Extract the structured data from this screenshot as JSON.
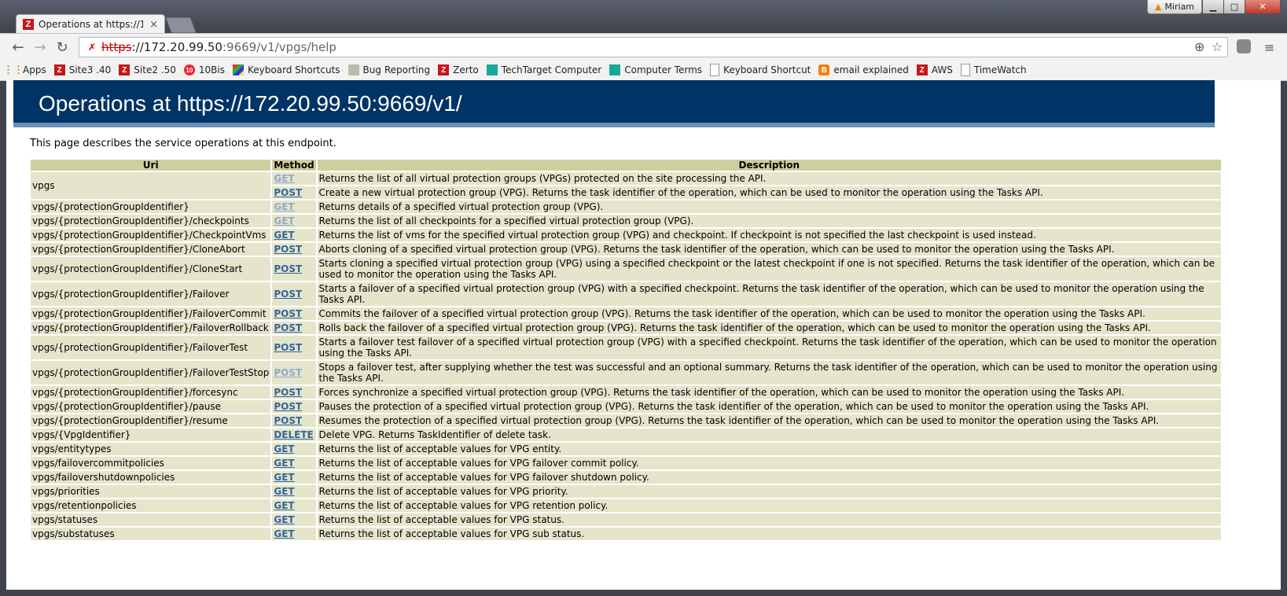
{
  "browser": {
    "tab_title": "Operations at https://172.",
    "tab_close": "×",
    "profile_name": "Miriam",
    "url_scheme": "https",
    "url_host": "://172.20.99.50",
    "url_path": ":9669/v1/vpgs/help"
  },
  "bookmarks": [
    {
      "label": "Apps",
      "icon": "apps-grid-icon"
    },
    {
      "label": "Site3 .40",
      "icon": "zerto-icon"
    },
    {
      "label": "Site2 .50",
      "icon": "zerto-icon"
    },
    {
      "label": "10Bis",
      "icon": "tenbis-icon"
    },
    {
      "label": "Keyboard Shortcuts",
      "icon": "colorful-icon"
    },
    {
      "label": "Bug Reporting",
      "icon": "bug-icon"
    },
    {
      "label": "Zerto",
      "icon": "zerto-icon"
    },
    {
      "label": "TechTarget Computer",
      "icon": "teal-icon"
    },
    {
      "label": "Computer Terms",
      "icon": "teal-icon"
    },
    {
      "label": "Keyboard Shortcut",
      "icon": "page-icon"
    },
    {
      "label": "email explained",
      "icon": "blogger-icon"
    },
    {
      "label": "AWS",
      "icon": "zerto-icon"
    },
    {
      "label": "TimeWatch",
      "icon": "page-icon"
    }
  ],
  "page": {
    "heading": "Operations at https://172.20.99.50:9669/v1/",
    "intro": "This page describes the service operations at this endpoint.",
    "columns": {
      "uri": "Uri",
      "method": "Method",
      "description": "Description"
    },
    "rows": [
      {
        "uri": "vpgs",
        "method": "GET",
        "visited": true,
        "desc": "Returns the list of all virtual protection groups (VPGs) protected on the site processing the API.",
        "rowspan": 2
      },
      {
        "uri": null,
        "method": "POST",
        "visited": false,
        "desc": "Create a new virtual protection group (VPG). Returns the task identifier of the operation, which can be used to monitor the operation using the Tasks API."
      },
      {
        "uri": "vpgs/{protectionGroupIdentifier}",
        "method": "GET",
        "visited": true,
        "desc": "Returns details of a specified virtual protection group (VPG)."
      },
      {
        "uri": "vpgs/{protectionGroupIdentifier}/checkpoints",
        "method": "GET",
        "visited": true,
        "desc": "Returns the list of all checkpoints for a specified virtual protection group (VPG)."
      },
      {
        "uri": "vpgs/{protectionGroupIdentifier}/CheckpointVms",
        "method": "GET",
        "visited": false,
        "desc": "Returns the list of vms for the specified virtual protection group (VPG) and checkpoint. If checkpoint is not specified the last checkpoint is used instead."
      },
      {
        "uri": "vpgs/{protectionGroupIdentifier}/CloneAbort",
        "method": "POST",
        "visited": false,
        "desc": "Aborts cloning of a specified virtual protection group (VPG). Returns the task identifier of the operation, which can be used to monitor the operation using the Tasks API."
      },
      {
        "uri": "vpgs/{protectionGroupIdentifier}/CloneStart",
        "method": "POST",
        "visited": false,
        "desc": "Starts cloning a specified virtual protection group (VPG) using a specified checkpoint or the latest checkpoint if one is not specified. Returns the task identifier of the operation, which can be used to monitor the operation using the Tasks API."
      },
      {
        "uri": "vpgs/{protectionGroupIdentifier}/Failover",
        "method": "POST",
        "visited": false,
        "desc": "Starts a failover of a specified virtual protection group (VPG) with a specified checkpoint. Returns the task identifier of the operation, which can be used to monitor the operation using the Tasks API."
      },
      {
        "uri": "vpgs/{protectionGroupIdentifier}/FailoverCommit",
        "method": "POST",
        "visited": false,
        "desc": "Commits the failover of a specified virtual protection group (VPG). Returns the task identifier of the operation, which can be used to monitor the operation using the Tasks API."
      },
      {
        "uri": "vpgs/{protectionGroupIdentifier}/FailoverRollback",
        "method": "POST",
        "visited": false,
        "desc": "Rolls back the failover of a specified virtual protection group (VPG). Returns the task identifier of the operation, which can be used to monitor the operation using the Tasks API."
      },
      {
        "uri": "vpgs/{protectionGroupIdentifier}/FailoverTest",
        "method": "POST",
        "visited": false,
        "desc": "Starts a failover test failover of a specified virtual protection group (VPG) with a specified checkpoint. Returns the task identifier of the operation, which can be used to monitor the operation using the Tasks API."
      },
      {
        "uri": "vpgs/{protectionGroupIdentifier}/FailoverTestStop",
        "method": "POST",
        "visited": true,
        "desc": "Stops a failover test, after supplying whether the test was successful and an optional summary. Returns the task identifier of the operation, which can be used to monitor the operation using the Tasks API."
      },
      {
        "uri": "vpgs/{protectionGroupIdentifier}/forcesync",
        "method": "POST",
        "visited": false,
        "desc": "Forces synchronize a specified virtual protection group (VPG). Returns the task identifier of the operation, which can be used to monitor the operation using the Tasks API."
      },
      {
        "uri": "vpgs/{protectionGroupIdentifier}/pause",
        "method": "POST",
        "visited": false,
        "desc": "Pauses the protection of a specified virtual protection group (VPG). Returns the task identifier of the operation, which can be used to monitor the operation using the Tasks API."
      },
      {
        "uri": "vpgs/{protectionGroupIdentifier}/resume",
        "method": "POST",
        "visited": false,
        "desc": "Resumes the protection of a specified virtual protection group (VPG). Returns the task identifier of the operation, which can be used to monitor the operation using the Tasks API."
      },
      {
        "uri": "vpgs/{VpgIdentifier}",
        "method": "DELETE",
        "visited": false,
        "desc": "Delete VPG. Returns TaskIdentifier of delete task."
      },
      {
        "uri": "vpgs/entitytypes",
        "method": "GET",
        "visited": false,
        "desc": "Returns the list of acceptable values for VPG entity."
      },
      {
        "uri": "vpgs/failovercommitpolicies",
        "method": "GET",
        "visited": false,
        "desc": "Returns the list of acceptable values for VPG failover commit policy."
      },
      {
        "uri": "vpgs/failovershutdownpolicies",
        "method": "GET",
        "visited": false,
        "desc": "Returns the list of acceptable values for VPG failover shutdown policy."
      },
      {
        "uri": "vpgs/priorities",
        "method": "GET",
        "visited": false,
        "desc": "Returns the list of acceptable values for VPG priority."
      },
      {
        "uri": "vpgs/retentionpolicies",
        "method": "GET",
        "visited": false,
        "desc": "Returns the list of acceptable values for VPG retention policy."
      },
      {
        "uri": "vpgs/statuses",
        "method": "GET",
        "visited": false,
        "desc": "Returns the list of acceptable values for VPG status."
      },
      {
        "uri": "vpgs/substatuses",
        "method": "GET",
        "visited": false,
        "desc": "Returns the list of acceptable values for VPG sub status."
      }
    ]
  },
  "colors": {
    "header_bg": "#003366",
    "table_header": "#cecf9c",
    "table_cell": "#e5e5cc",
    "link": "#336699",
    "link_visited": "#8fa9c7"
  }
}
